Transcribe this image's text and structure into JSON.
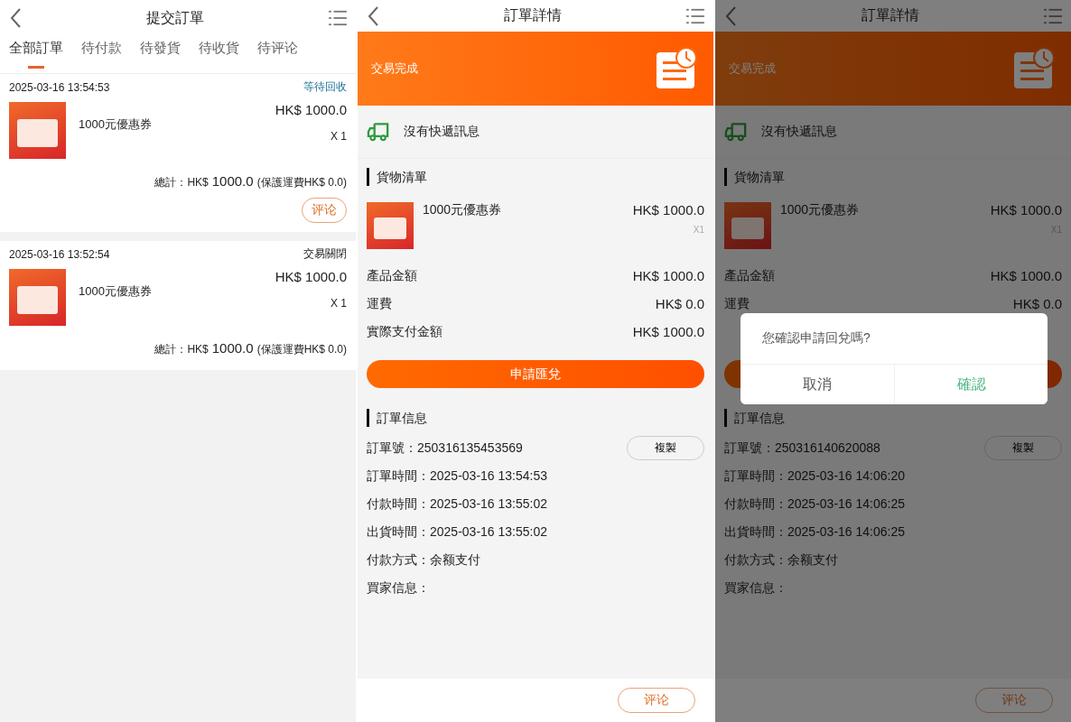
{
  "order_list": {
    "title": "提交訂單",
    "tabs": [
      {
        "label": "全部訂單",
        "selected": true
      },
      {
        "label": "待付款",
        "selected": false
      },
      {
        "label": "待發貨",
        "selected": false
      },
      {
        "label": "待收貨",
        "selected": false
      },
      {
        "label": "待评论",
        "selected": false
      }
    ],
    "orders": [
      {
        "time": "2025-03-16 13:54:53",
        "status": "等待回收",
        "kind": "pending",
        "product": {
          "name": "1000元優惠券",
          "price": "HK$ 1000.0",
          "qty": "X 1"
        },
        "total_label": "總計：HK$",
        "total_amount": "1000.0",
        "shipping_note": "(保護運費HK$ 0.0)",
        "review_button": "评论"
      },
      {
        "time": "2025-03-16 13:52:54",
        "status": "交易關閉",
        "kind": "closed",
        "product": {
          "name": "1000元優惠券",
          "price": "HK$ 1000.0",
          "qty": "X 1"
        },
        "total_label": "總計：HK$",
        "total_amount": "1000.0",
        "shipping_note": "(保護運費HK$ 0.0)"
      }
    ]
  },
  "details": [
    {
      "title": "訂單詳情",
      "status": "交易完成",
      "shipping_info": "沒有快遞訊息",
      "goods_heading": "貨物清單",
      "item": {
        "name": "1000元優惠券",
        "price": "HK$ 1000.0",
        "qty": "X1"
      },
      "summary": [
        {
          "label": "產品金額",
          "value": "HK$ 1000.0"
        },
        {
          "label": "運費",
          "value": "HK$ 0.0"
        },
        {
          "label": "實際支付金額",
          "value": "HK$ 1000.0"
        }
      ],
      "apply_button": "申請匯兌",
      "info_heading": "訂單信息",
      "info": [
        "訂單號：250316135453569",
        "訂單時間：2025-03-16 13:54:53",
        "付款時間：2025-03-16 13:55:02",
        "出貨時間：2025-03-16 13:55:02",
        "付款方式：余额支付",
        "買家信息："
      ],
      "copy_button": "複製",
      "review_button": "评论"
    },
    {
      "title": "訂單詳情",
      "status": "交易完成",
      "shipping_info": "沒有快遞訊息",
      "goods_heading": "貨物清單",
      "item": {
        "name": "1000元優惠券",
        "price": "HK$ 1000.0",
        "qty": "X1"
      },
      "summary": [
        {
          "label": "產品金額",
          "value": "HK$ 1000.0"
        },
        {
          "label": "運費",
          "value": "HK$ 0.0"
        }
      ],
      "info_heading": "訂單信息",
      "info": [
        "訂單號：250316140620088",
        "訂單時間：2025-03-16 14:06:20",
        "付款時間：2025-03-16 14:06:25",
        "出貨時間：2025-03-16 14:06:25",
        "付款方式：余额支付",
        "買家信息："
      ],
      "copy_button": "複製",
      "review_button": "评论",
      "dialog": {
        "message": "您確認申請回兌嗎?",
        "buttons": [
          {
            "label": "取消",
            "kind": "cancel"
          },
          {
            "label": "確認",
            "kind": "confirm"
          }
        ]
      }
    }
  ]
}
